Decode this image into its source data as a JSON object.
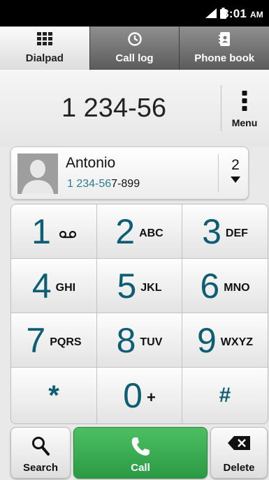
{
  "status_bar": {
    "time": "3:01",
    "ampm": "AM",
    "icons": [
      "signal-icon",
      "battery-icon"
    ]
  },
  "tabs": [
    {
      "label": "Dialpad",
      "icon": "dialpad-grid-icon",
      "active": true
    },
    {
      "label": "Call log",
      "icon": "clock-icon",
      "active": false
    },
    {
      "label": "Phone book",
      "icon": "phonebook-icon",
      "active": false
    }
  ],
  "display": {
    "number": "1 234-56",
    "menu_label": "Menu"
  },
  "suggestion": {
    "name": "Antonio",
    "number_matched": "1 234-56",
    "number_rest": "7-899",
    "match_count": "2"
  },
  "keypad": {
    "keys": [
      {
        "digit": "1",
        "letters": ""
      },
      {
        "digit": "2",
        "letters": "ABC"
      },
      {
        "digit": "3",
        "letters": "DEF"
      },
      {
        "digit": "4",
        "letters": "GHI"
      },
      {
        "digit": "5",
        "letters": "JKL"
      },
      {
        "digit": "6",
        "letters": "MNO"
      },
      {
        "digit": "7",
        "letters": "PQRS"
      },
      {
        "digit": "8",
        "letters": "TUV"
      },
      {
        "digit": "9",
        "letters": "WXYZ"
      },
      {
        "digit": "*",
        "letters": ""
      },
      {
        "digit": "0",
        "letters": "+"
      },
      {
        "digit": "#",
        "letters": ""
      }
    ]
  },
  "actions": {
    "search_label": "Search",
    "call_label": "Call",
    "delete_label": "Delete"
  },
  "colors": {
    "accent": "#0d5d73",
    "call_green": "#2fa34a",
    "match_blue": "#2a7d8f"
  }
}
